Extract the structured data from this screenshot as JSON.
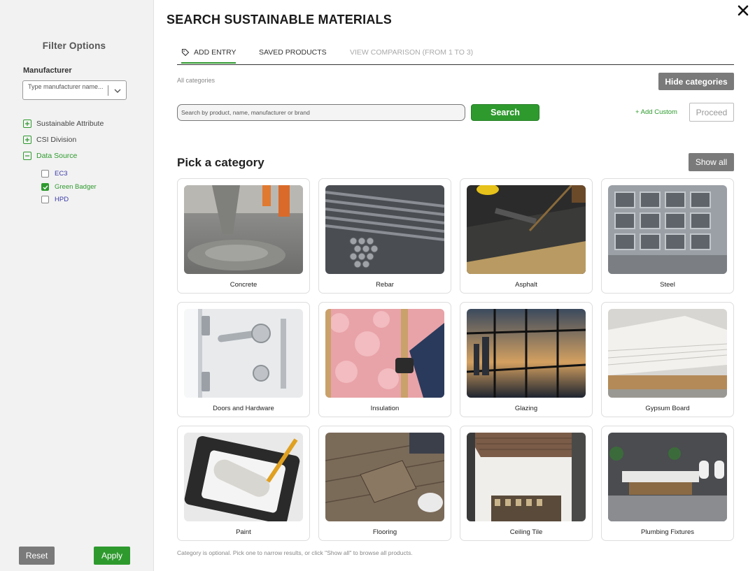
{
  "sidebar": {
    "title": "Filter Options",
    "manufacturer_label": "Manufacturer",
    "manufacturer_placeholder": "Type manufacturer name...",
    "filters": [
      {
        "label": "Sustainable Attribute",
        "expanded": false
      },
      {
        "label": "CSI Division",
        "expanded": false
      },
      {
        "label": "Data Source",
        "expanded": true
      }
    ],
    "data_sources": [
      {
        "label": "EC3",
        "checked": false
      },
      {
        "label": "Green Badger",
        "checked": true
      },
      {
        "label": "HPD",
        "checked": false
      }
    ],
    "reset_label": "Reset",
    "apply_label": "Apply"
  },
  "header": {
    "title": "SEARCH SUSTAINABLE MATERIALS",
    "close_icon": "close-icon"
  },
  "tabs": [
    {
      "label": "ADD ENTRY",
      "icon": "tag-icon",
      "state": "active"
    },
    {
      "label": "SAVED PRODUCTS",
      "state": "normal"
    },
    {
      "label": "VIEW COMPARISON (FROM 1 TO 3)",
      "state": "disabled"
    }
  ],
  "categories_bar": {
    "breadcrumb": "All categories",
    "hide_label": "Hide categories"
  },
  "search": {
    "placeholder": "Search by product, name, manufacturer or brand",
    "value": "",
    "button_label": "Search",
    "add_custom_label": "+ Add Custom",
    "proceed_label": "Proceed"
  },
  "pick": {
    "title": "Pick a category",
    "show_all_label": "Show all",
    "categories": [
      {
        "label": "Concrete"
      },
      {
        "label": "Rebar"
      },
      {
        "label": "Asphalt"
      },
      {
        "label": "Steel"
      },
      {
        "label": "Doors and Hardware"
      },
      {
        "label": "Insulation"
      },
      {
        "label": "Glazing"
      },
      {
        "label": "Gypsum Board"
      },
      {
        "label": "Paint"
      },
      {
        "label": "Flooring"
      },
      {
        "label": "Ceiling Tile"
      },
      {
        "label": "Plumbing Fixtures"
      }
    ],
    "footnote": "Category is optional. Pick one to narrow results, or click \"Show all\" to browse all products."
  },
  "colors": {
    "accent_green": "#2e9a2e",
    "neutral_button": "#7a7a7a",
    "sidebar_bg": "#f2f2f2"
  }
}
